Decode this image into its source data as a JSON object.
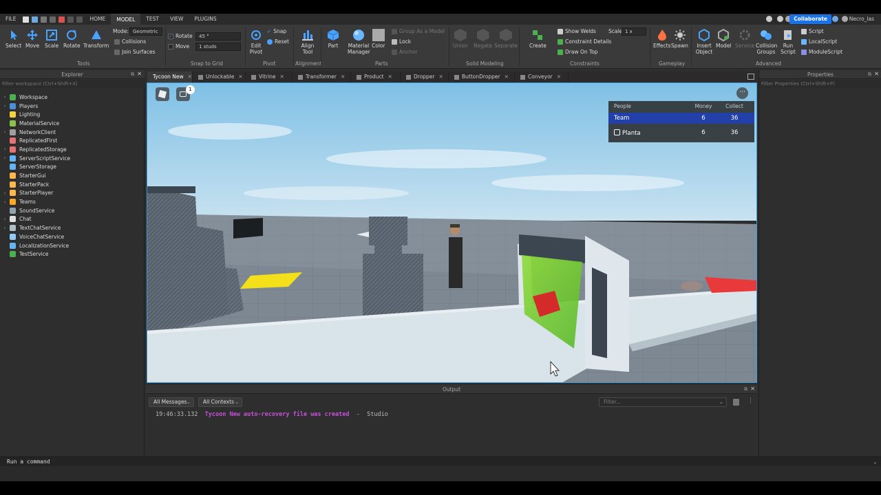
{
  "menubar": {
    "tabs": [
      "FILE",
      "HOME",
      "MODEL",
      "TEST",
      "VIEW",
      "PLUGINS"
    ],
    "active_tab": "MODEL",
    "collaborate_label": "Collaborate",
    "username": "Necro_las"
  },
  "ribbon": {
    "tools": {
      "select": "Select",
      "move": "Move",
      "scale": "Scale",
      "rotate": "Rotate",
      "transform": "Transform",
      "group": "Tools"
    },
    "mode_label": "Mode:",
    "mode_value": "Geometric",
    "collisions": "Collisions",
    "join_surfaces": "Join Surfaces",
    "snap": {
      "rotate_label": "Rotate",
      "rotate_value": "45 °",
      "move_label": "Move",
      "move_value": "1 studs",
      "group": "Snap to Grid"
    },
    "pivot": {
      "edit_pivot": "Edit Pivot",
      "snap": "Snap",
      "reset": "Reset",
      "group": "Pivot"
    },
    "alignment": {
      "align_tool": "Align Tool",
      "group": "Alignment"
    },
    "parts": {
      "part": "Part",
      "material_manager": "Material Manager",
      "color": "Color",
      "group_as_model": "Group As a Model",
      "lock": "Lock",
      "anchor": "Anchor",
      "group": "Parts"
    },
    "solid_modeling": {
      "union": "Union",
      "negate": "Negate",
      "separate": "Separate",
      "group": "Solid Modeling"
    },
    "constraints": {
      "create": "Create",
      "show_welds": "Show Welds",
      "constraint_details": "Constraint Details",
      "draw_on_top": "Draw On Top",
      "scale_label": "Scale",
      "scale_value": "1 x",
      "group": "Constraints"
    },
    "gameplay": {
      "effects": "Effects",
      "spawn": "Spawn",
      "group": "Gameplay"
    },
    "advanced": {
      "insert_object": "Insert Object",
      "model": "Model",
      "service": "Service",
      "collision_groups": "Collision Groups",
      "run_script": "Run Script",
      "script": "Script",
      "local_script": "LocalScript",
      "module_script": "ModuleScript",
      "group": "Advanced"
    }
  },
  "explorer": {
    "title": "Explorer",
    "filter_placeholder": "Filter workspace (Ctrl+Shift+X)",
    "items": [
      {
        "label": "Workspace",
        "color": "#4caf50",
        "expand": true
      },
      {
        "label": "Players",
        "color": "#4a90d9",
        "expand": true
      },
      {
        "label": "Lighting",
        "color": "#f5d142",
        "expand": false
      },
      {
        "label": "MaterialService",
        "color": "#8bc34a",
        "expand": false
      },
      {
        "label": "NetworkClient",
        "color": "#9e9e9e",
        "expand": true
      },
      {
        "label": "ReplicatedFirst",
        "color": "#e57373",
        "expand": false
      },
      {
        "label": "ReplicatedStorage",
        "color": "#e57373",
        "expand": true
      },
      {
        "label": "ServerScriptService",
        "color": "#64b5f6",
        "expand": true
      },
      {
        "label": "ServerStorage",
        "color": "#64b5f6",
        "expand": false
      },
      {
        "label": "StarterGui",
        "color": "#ffb74d",
        "expand": false
      },
      {
        "label": "StarterPack",
        "color": "#ffb74d",
        "expand": false
      },
      {
        "label": "StarterPlayer",
        "color": "#ffb74d",
        "expand": true
      },
      {
        "label": "Teams",
        "color": "#ffa726",
        "expand": true
      },
      {
        "label": "SoundService",
        "color": "#90a4ae",
        "expand": false
      },
      {
        "label": "Chat",
        "color": "#e0e0e0",
        "expand": true
      },
      {
        "label": "TextChatService",
        "color": "#b0bec5",
        "expand": true
      },
      {
        "label": "VoiceChatService",
        "color": "#90caf9",
        "expand": false
      },
      {
        "label": "LocalizationService",
        "color": "#64b5f6",
        "expand": false
      },
      {
        "label": "TestService",
        "color": "#4caf50",
        "expand": false
      }
    ]
  },
  "properties": {
    "title": "Properties",
    "filter_placeholder": "Filter Properties (Ctrl+Shift+P)"
  },
  "tabs": [
    {
      "label": "Tycoon New",
      "active": true
    },
    {
      "label": "Unlockable",
      "active": false
    },
    {
      "label": "Vitrine",
      "active": false
    },
    {
      "label": "Transformer",
      "active": false
    },
    {
      "label": "Product",
      "active": false
    },
    {
      "label": "Dropper",
      "active": false
    },
    {
      "label": "ButtonDropper",
      "active": false
    },
    {
      "label": "Conveyor",
      "active": false
    }
  ],
  "viewport": {
    "chat_badge": "1",
    "leaderboard": {
      "headers": [
        "People",
        "Money",
        "Collect"
      ],
      "rows": [
        {
          "name": "Team",
          "money": "6",
          "collect": "36"
        },
        {
          "name": "Planta",
          "money": "6",
          "collect": "36"
        }
      ]
    }
  },
  "output": {
    "title": "Output",
    "messages_filter": "All Messages",
    "contexts_filter": "All Contexts",
    "search_placeholder": "Filter...",
    "line_time": "19:46:33.132",
    "line_message": "Tycoon New auto-recovery file was created",
    "line_source": "Studio"
  },
  "command_bar": {
    "placeholder": "Run a command"
  }
}
